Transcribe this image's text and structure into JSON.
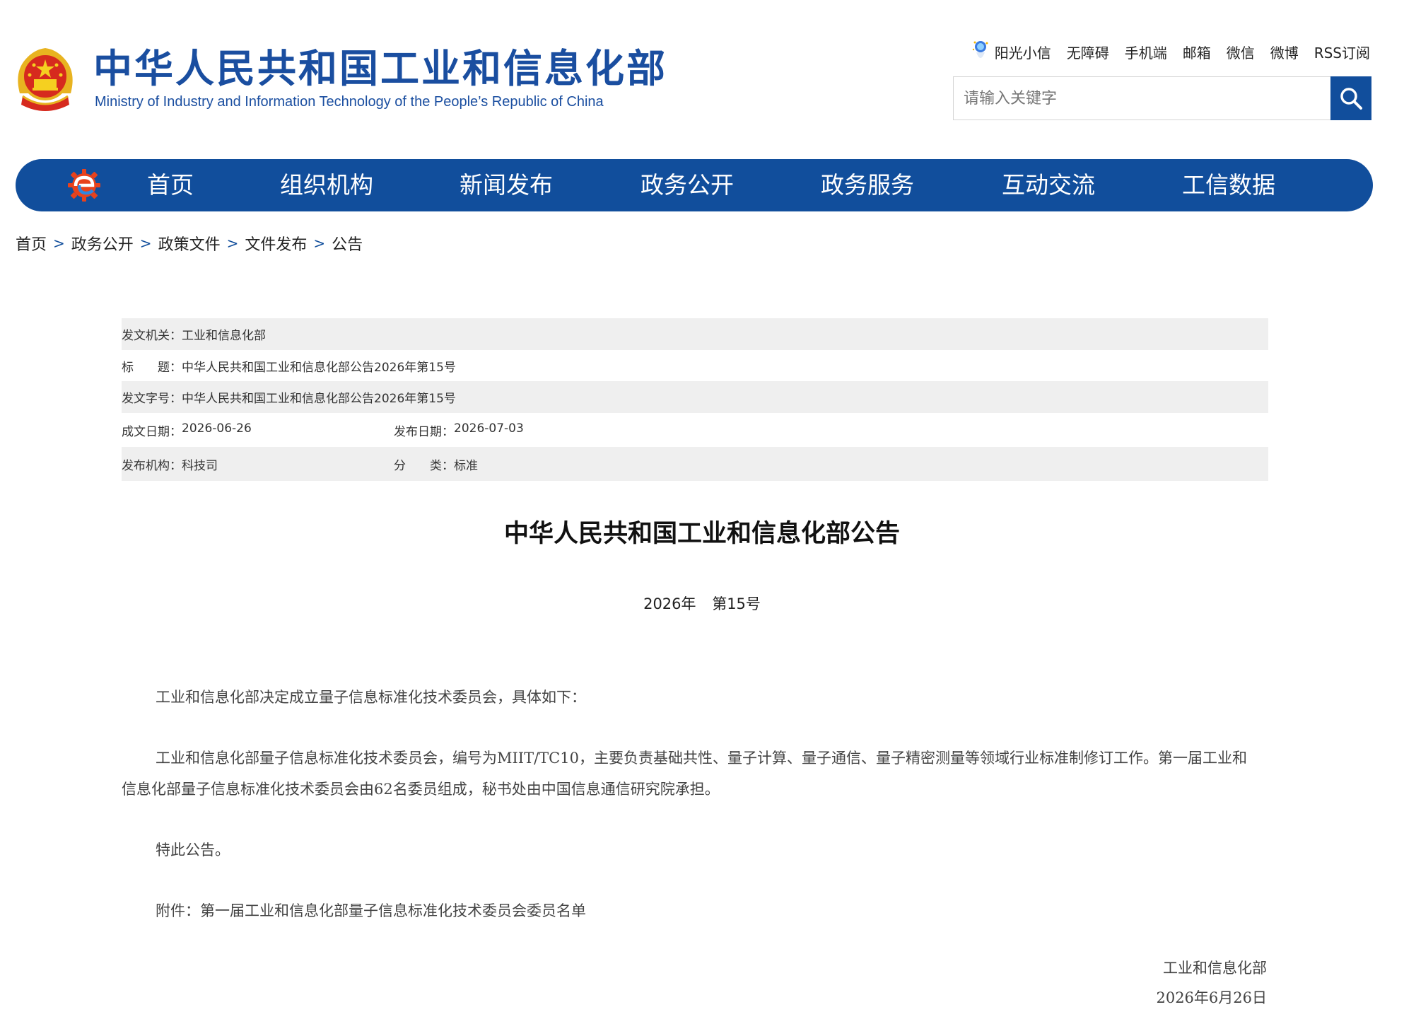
{
  "header": {
    "title": "中华人民共和国工业和信息化部",
    "subtitle": "Ministry of Industry and Information Technology of the People’s Republic of China",
    "quicklinks": [
      "阳光小信",
      "无障碍",
      "手机端",
      "邮箱",
      "微信",
      "微博",
      "RSS订阅"
    ],
    "search_placeholder": "请输入关键字"
  },
  "nav": {
    "items": [
      "首页",
      "组织机构",
      "新闻发布",
      "政务公开",
      "政务服务",
      "互动交流",
      "工信数据"
    ],
    "bg_color": "#114e9c"
  },
  "breadcrumb": {
    "items": [
      "首页",
      "政务公开",
      "政策文件",
      "文件发布",
      "公告"
    ],
    "separator": ">"
  },
  "meta": {
    "issuer_label": "发文机关：",
    "issuer": "工业和信息化部",
    "title_label": "标　　题：",
    "title": "中华人民共和国工业和信息化部公告2026年第15号",
    "docno_label": "发文字号：",
    "docno": "中华人民共和国工业和信息化部公告2026年第15号",
    "created_label": "成文日期：",
    "created": "2026-06-26",
    "published_label": "发布日期：",
    "published": "2026-07-03",
    "org_label": "发布机构：",
    "org": "科技司",
    "category_label": "分　　类：",
    "category": "标准"
  },
  "article": {
    "title": "中华人民共和国工业和信息化部公告",
    "number": "2026年 第15号",
    "p1": "工业和信息化部决定成立量子信息标准化技术委员会，具体如下：",
    "p2": "工业和信息化部量子信息标准化技术委员会，编号为MIIT/TC10，主要负责基础共性、量子计算、量子通信、量子精密测量等领域行业标准制修订工作。第一届工业和信息化部量子信息标准化技术委员会由62名委员组成，秘书处由中国信息通信研究院承担。",
    "p3": "特此公告。",
    "p4": "附件：第一届工业和信息化部量子信息标准化技术委员会委员名单",
    "sign_org": "工业和信息化部",
    "sign_date": "2026年6月26日"
  }
}
